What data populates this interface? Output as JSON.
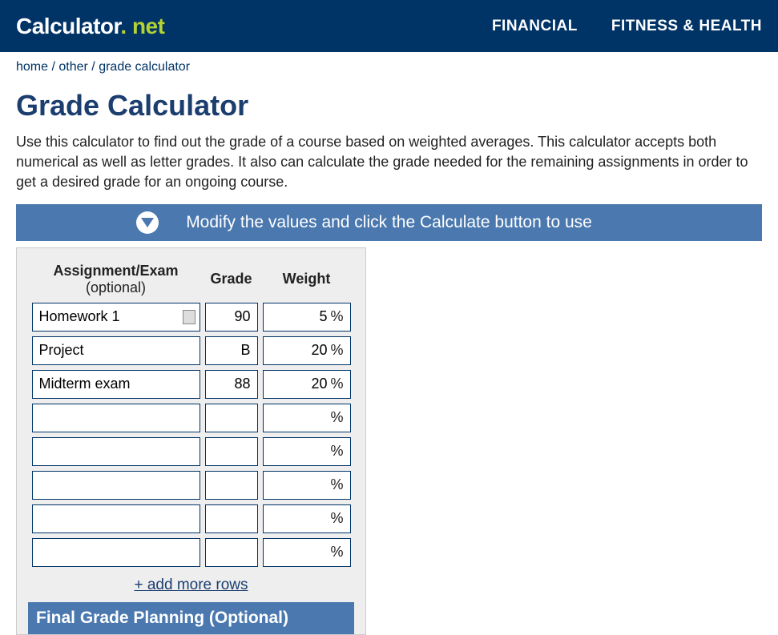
{
  "header": {
    "logo_main": "Calculator",
    "logo_dot": ".",
    "logo_net": "net",
    "nav": [
      "FINANCIAL",
      "FITNESS & HEALTH"
    ]
  },
  "breadcrumb": {
    "home": "home",
    "other": "other",
    "current": "grade calculator"
  },
  "title": "Grade Calculator",
  "description": "Use this calculator to find out the grade of a course based on weighted averages. This calculator accepts both numerical as well as letter grades. It also can calculate the grade needed for the remaining assignments in order to get a desired grade for an ongoing course.",
  "banner": "Modify the values and click the Calculate button to use",
  "table": {
    "col_assignment": "Assignment/Exam",
    "col_assignment_opt": "(optional)",
    "col_grade": "Grade",
    "col_weight": "Weight",
    "rows": [
      {
        "assignment": "Homework 1",
        "grade": "90",
        "weight": "5"
      },
      {
        "assignment": "Project",
        "grade": "B",
        "weight": "20"
      },
      {
        "assignment": "Midterm exam",
        "grade": "88",
        "weight": "20"
      },
      {
        "assignment": "",
        "grade": "",
        "weight": ""
      },
      {
        "assignment": "",
        "grade": "",
        "weight": ""
      },
      {
        "assignment": "",
        "grade": "",
        "weight": ""
      },
      {
        "assignment": "",
        "grade": "",
        "weight": ""
      },
      {
        "assignment": "",
        "grade": "",
        "weight": ""
      }
    ],
    "pct": "%",
    "add_more": "+ add more rows"
  },
  "final_title": "Final Grade Planning (Optional)"
}
